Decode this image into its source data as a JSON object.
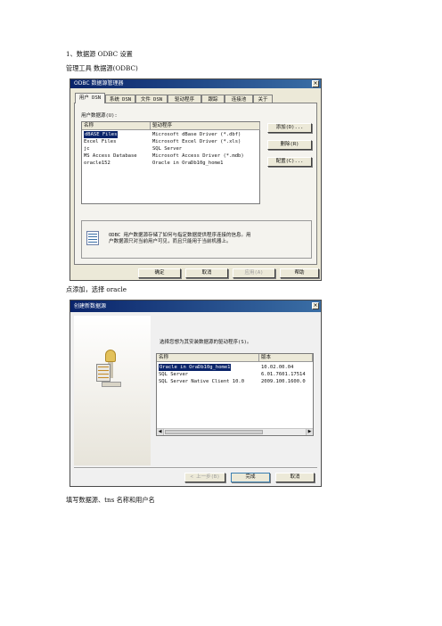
{
  "doc": {
    "heading": "1、数据源 ODBC 设置",
    "path": "管理工具 数据源(ODBC)",
    "step2": "点添加，选择 oracle",
    "step3": "填写数据源、tns 名称和用户名"
  },
  "odbc_dialog": {
    "title": "ODBC 数据源管理器",
    "close_glyph": "×",
    "tabs": [
      "用户 DSN",
      "系统 DSN",
      "文件 DSN",
      "驱动程序",
      "跟踪",
      "连接池",
      "关于"
    ],
    "group_label": "用户数据源(U):",
    "columns": [
      "名称",
      "驱动程序"
    ],
    "rows": [
      {
        "name": "dBASE Files",
        "driver": "Microsoft dBase Driver (*.dbf)"
      },
      {
        "name": "Excel Files",
        "driver": "Microsoft Excel Driver (*.xls)"
      },
      {
        "name": "jc",
        "driver": "SQL Server"
      },
      {
        "name": "MS Access Database",
        "driver": "Microsoft Access Driver (*.mdb)"
      },
      {
        "name": "oracle152",
        "driver": "Oracle in OraDb10g_home1"
      }
    ],
    "side_buttons": {
      "add": "添加(D)...",
      "remove": "删除(R)",
      "configure": "配置(C)..."
    },
    "info_text_line1": "ODBC 用户数据源存储了如何与指定数据提供程序连接的信息。用",
    "info_text_line2": "户数据源只对当前用户可见，而且只能用于当前机器上。",
    "footer_buttons": {
      "ok": "确定",
      "cancel": "取消",
      "apply": "应用(A)",
      "help": "帮助"
    }
  },
  "new_ds_dialog": {
    "title": "创建新数据源",
    "close_glyph": "×",
    "prompt": "选择您想为其安装数据源的驱动程序(S)。",
    "columns": [
      "名称",
      "版本"
    ],
    "rows": [
      {
        "name": "Oracle in OraDb10g_home1",
        "version": "10.02.00.04"
      },
      {
        "name": "SQL Server",
        "version": "6.01.7601.17514"
      },
      {
        "name": "SQL Server Native Client 10.0",
        "version": "2009.100.1600.0"
      }
    ],
    "buttons": {
      "back": "< 上一步(B)",
      "finish": "完成",
      "cancel": "取消"
    }
  }
}
